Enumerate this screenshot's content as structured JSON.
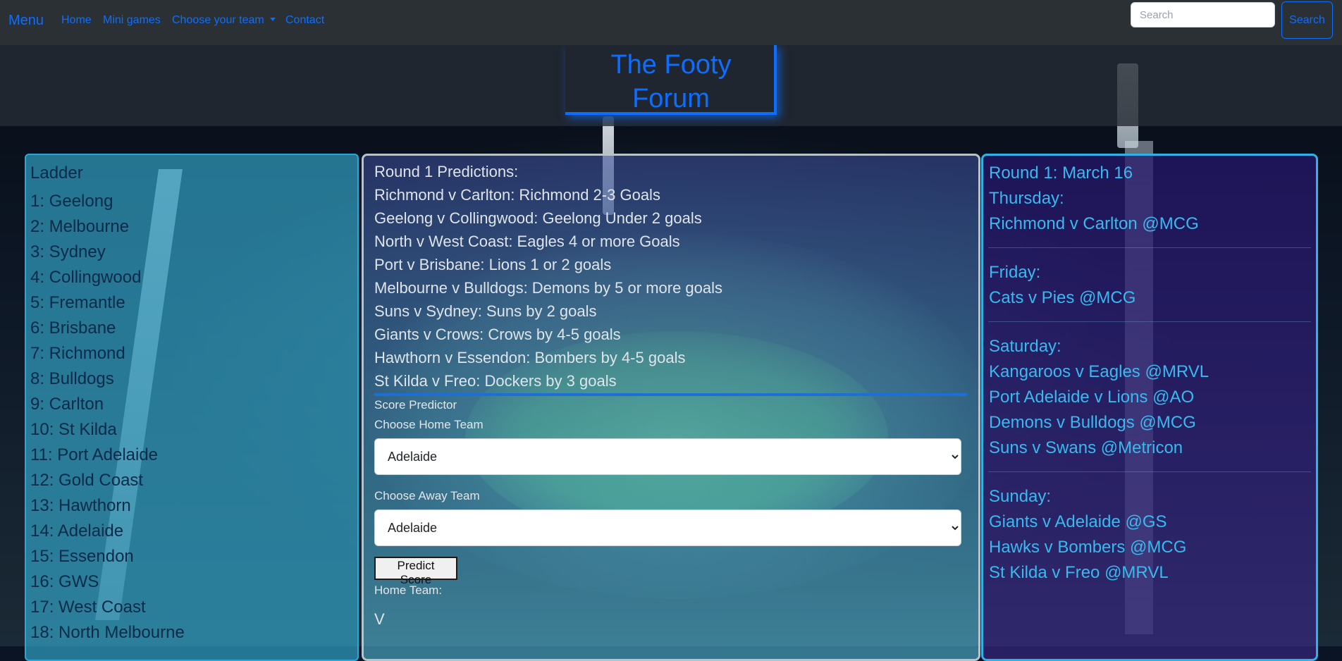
{
  "navbar": {
    "brand": "Menu",
    "links": [
      "Home",
      "Mini games",
      "Choose your team",
      "Contact"
    ],
    "search_placeholder": "Search",
    "search_button": "Search"
  },
  "header": {
    "title_line1": "The Footy",
    "title_line2": "Forum"
  },
  "ladder": {
    "title": "Ladder",
    "teams": [
      "1: Geelong",
      "2: Melbourne",
      "3: Sydney",
      "4: Collingwood",
      "5: Fremantle",
      "6: Brisbane",
      "7: Richmond",
      "8: Bulldogs",
      "9: Carlton",
      "10: St Kilda",
      "11: Port Adelaide",
      "12: Gold Coast",
      "13: Hawthorn",
      "14: Adelaide",
      "15: Essendon",
      "16: GWS",
      "17: West Coast",
      "18: North Melbourne"
    ]
  },
  "predictions": {
    "title": "Round 1 Predictions:",
    "items": [
      "Richmond v Carlton: Richmond 2-3 Goals",
      "Geelong v Collingwood: Geelong Under 2 goals",
      "North v West Coast: Eagles 4 or more Goals",
      "Port v Brisbane: Lions 1 or 2 goals",
      "Melbourne v Bulldogs: Demons by 5 or more goals",
      "Suns v Sydney: Suns by 2 goals",
      "Giants v Crows: Crows by 4-5 goals",
      "Hawthorn v Essendon: Bombers by 4-5 goals",
      "St Kilda v Freo: Dockers by 3 goals"
    ]
  },
  "predictor": {
    "title": "Score Predictor",
    "home_label": "Choose Home Team",
    "home_value": "Adelaide",
    "away_label": "Choose Away Team",
    "away_value": "Adelaide",
    "button": "Predict Score",
    "home_result_label": "Home Team:",
    "versus": "V"
  },
  "fixtures": {
    "round_title": "Round 1: March 16",
    "days": [
      {
        "day": "Thursday:",
        "games": [
          "Richmond v Carlton @MCG"
        ]
      },
      {
        "day": "Friday:",
        "games": [
          "Cats v Pies @MCG"
        ]
      },
      {
        "day": "Saturday:",
        "games": [
          "Kangaroos v Eagles @MRVL",
          "Port Adelaide v Lions @AO",
          "Demons v Bulldogs @MCG",
          "Suns v Swans @Metricon"
        ]
      },
      {
        "day": "Sunday:",
        "games": [
          "Giants v Adelaide @GS",
          "Hawks v Bombers @MCG",
          "St Kilda v Freo @MRVL"
        ]
      }
    ]
  },
  "colors": {
    "accent": "#0d6efd",
    "navbar_bg": "#2b3035",
    "fixture_text": "#39b9ee"
  }
}
